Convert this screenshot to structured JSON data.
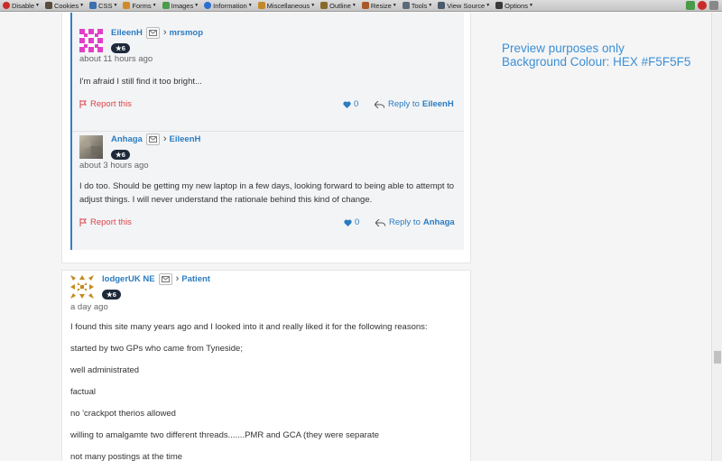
{
  "toolbar": {
    "items": [
      {
        "label": "Disable",
        "icon": "disable-icon",
        "color": "#cc2a2a"
      },
      {
        "label": "Cookies",
        "icon": "cookies-icon",
        "color": "#5a4a3a"
      },
      {
        "label": "CSS",
        "icon": "css-icon",
        "color": "#3a6fb0"
      },
      {
        "label": "Forms",
        "icon": "forms-icon",
        "color": "#d08a2a"
      },
      {
        "label": "Images",
        "icon": "images-icon",
        "color": "#4a9a4a"
      },
      {
        "label": "Information",
        "icon": "information-icon",
        "color": "#2a6fd0"
      },
      {
        "label": "Miscellaneous",
        "icon": "miscellaneous-icon",
        "color": "#c08a2a"
      },
      {
        "label": "Outline",
        "icon": "outline-icon",
        "color": "#8a6a2a"
      },
      {
        "label": "Resize",
        "icon": "resize-icon",
        "color": "#aa5a2a"
      },
      {
        "label": "Tools",
        "icon": "tools-icon",
        "color": "#5a6a7a"
      },
      {
        "label": "View Source",
        "icon": "view-source-icon",
        "color": "#4a5a6a"
      },
      {
        "label": "Options",
        "icon": "options-icon",
        "color": "#3a3a3a"
      }
    ]
  },
  "replies": [
    {
      "author": "EileenH",
      "reply_to_user": "mrsmop",
      "rank": "★6",
      "time": "about 11 hours ago",
      "text": "I'm afraid I still find it too bright...",
      "report_label": "Report this",
      "likes": "0",
      "reply_label": "Reply to",
      "reply_name": "EileenH"
    },
    {
      "author": "Anhaga",
      "reply_to_user": "EileenH",
      "rank": "★6",
      "time": "about 3 hours ago",
      "text": "I do too.  Should be getting my new laptop in a few days, looking forward to being able to attempt to adjust things.  I will never understand the rationale behind this kind of change.",
      "report_label": "Report this",
      "likes": "0",
      "reply_label": "Reply to",
      "reply_name": "Anhaga"
    }
  ],
  "post": {
    "author": "lodgerUK NE",
    "reply_to_user": "Patient",
    "rank": "★6",
    "time": "a day ago",
    "paragraphs": [
      "I found this site many years ago and I looked into it and really liked it for the following reasons:",
      "started by two GPs who came from Tyneside;",
      "well administrated",
      "factual",
      "no 'crackpot therios allowed",
      "willing to amalgamte two different threads.......PMR and GCA (they were separate",
      "not many postings at the time"
    ]
  },
  "preview_note": {
    "line1": "Preview purposes only",
    "line2": "Background Colour: HEX #F5F5F5"
  },
  "colors": {
    "background": "#F5F5F5",
    "link": "#2a7cc1",
    "report": "#d9464b",
    "thread_line": "#3a7fc1"
  }
}
